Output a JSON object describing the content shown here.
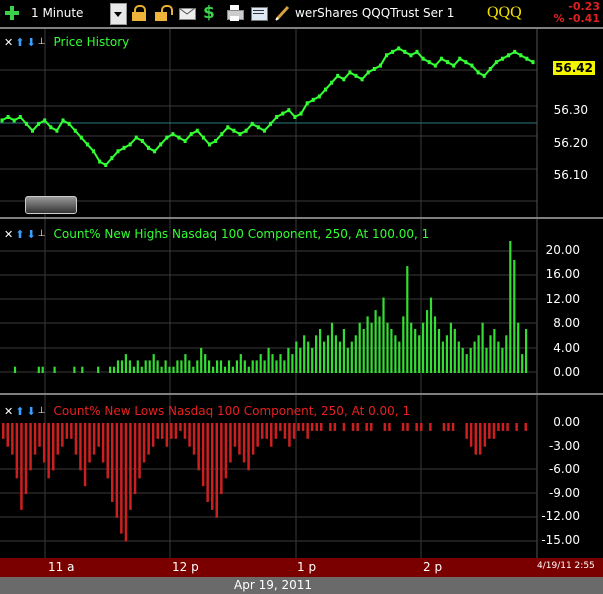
{
  "toolbar": {
    "interval_label": "1 Minute",
    "symbol_name": "werShares QQQTrust Ser 1",
    "ticker": "QQQ",
    "change": "-0.23",
    "change_pct": "% -0.41"
  },
  "pane1": {
    "title": "Price History",
    "last_price": "56.42",
    "axis": [
      "56.30",
      "56.20",
      "56.10"
    ]
  },
  "pane2": {
    "title": "Count% New Highs Nasdaq 100 Component, 250, At 100.00, 1",
    "axis": [
      "20.00",
      "16.00",
      "12.00",
      "8.00",
      "4.00",
      "0.00"
    ]
  },
  "pane3": {
    "title": "Count% New Lows Nasdaq 100 Component, 250, At 0.00, 1",
    "axis": [
      "0.00",
      "-3.00",
      "-6.00",
      "-9.00",
      "-12.00",
      "-15.00"
    ]
  },
  "footer": {
    "time_labels": [
      "11 a",
      "12 p",
      "1 p",
      "2 p"
    ],
    "timestamp": "4/19/11 2:55",
    "date": "Apr 19, 2011"
  },
  "colors": {
    "price_line": "#33ff33",
    "highs": "#33dd33",
    "lows": "#cc2020",
    "footer": "#7a0000"
  },
  "chart_data": [
    {
      "type": "line",
      "ylim": [
        56.05,
        56.47
      ],
      "x_labels": [
        "11 a",
        "12 p",
        "1 p",
        "2 p"
      ],
      "series": [
        {
          "values": [
            56.25,
            56.26,
            56.25,
            56.26,
            56.24,
            56.22,
            56.24,
            56.25,
            56.23,
            56.22,
            56.25,
            56.24,
            56.22,
            56.2,
            56.18,
            56.16,
            56.13,
            56.12,
            56.14,
            56.16,
            56.17,
            56.18,
            56.2,
            56.19,
            56.17,
            56.16,
            56.18,
            56.2,
            56.21,
            56.2,
            56.19,
            56.21,
            56.22,
            56.2,
            56.18,
            56.19,
            56.21,
            56.23,
            56.22,
            56.21,
            56.22,
            56.24,
            56.23,
            56.22,
            56.24,
            56.26,
            56.27,
            56.28,
            56.26,
            56.27,
            56.3,
            56.31,
            56.32,
            56.34,
            56.36,
            56.38,
            56.37,
            56.39,
            56.38,
            56.37,
            56.39,
            56.4,
            56.41,
            56.44,
            56.45,
            56.46,
            56.45,
            56.44,
            56.45,
            56.43,
            56.42,
            56.41,
            56.43,
            56.42,
            56.41,
            56.43,
            56.42,
            56.41,
            56.39,
            56.38,
            56.4,
            56.42,
            56.43,
            56.44,
            56.45,
            56.44,
            56.43,
            56.42
          ]
        }
      ]
    },
    {
      "type": "bar",
      "ylim": [
        0,
        21
      ],
      "values": [
        0,
        0,
        0,
        1,
        0,
        0,
        0,
        0,
        0,
        1,
        1,
        0,
        0,
        1,
        0,
        0,
        0,
        0,
        1,
        0,
        1,
        0,
        0,
        0,
        1,
        0,
        0,
        1,
        1,
        2,
        2,
        3,
        2,
        1,
        2,
        1,
        2,
        2,
        3,
        2,
        1,
        2,
        1,
        1,
        2,
        2,
        3,
        2,
        1,
        2,
        4,
        3,
        2,
        1,
        2,
        2,
        1,
        2,
        1,
        2,
        3,
        2,
        1,
        2,
        2,
        3,
        2,
        4,
        3,
        2,
        3,
        2,
        4,
        3,
        5,
        4,
        6,
        5,
        4,
        6,
        7,
        5,
        6,
        8,
        6,
        5,
        7,
        4,
        5,
        6,
        8,
        7,
        9,
        8,
        10,
        9,
        12,
        8,
        7,
        6,
        5,
        9,
        17,
        8,
        7,
        6,
        8,
        10,
        12,
        9,
        7,
        5,
        6,
        8,
        7,
        5,
        4,
        3,
        4,
        5,
        6,
        8,
        4,
        6,
        7,
        5,
        4,
        6,
        21,
        18,
        8,
        3,
        7
      ]
    },
    {
      "type": "bar",
      "ylim": [
        -16,
        1
      ],
      "values": [
        -2,
        -3,
        -4,
        -7,
        -11,
        -9,
        -6,
        -4,
        -3,
        -5,
        -7,
        -6,
        -4,
        -3,
        -2,
        -2,
        -4,
        -6,
        -8,
        -5,
        -4,
        -3,
        -5,
        -7,
        -10,
        -12,
        -14,
        -15,
        -11,
        -9,
        -7,
        -5,
        -4,
        -3,
        -2,
        -2,
        -3,
        -2,
        -2,
        -1,
        -2,
        -3,
        -4,
        -6,
        -8,
        -10,
        -11,
        -12,
        -9,
        -7,
        -5,
        -3,
        -4,
        -5,
        -6,
        -4,
        -3,
        -2,
        -2,
        -3,
        -2,
        -1,
        -2,
        -3,
        -2,
        -1,
        -1,
        -2,
        -1,
        -1,
        -1,
        0,
        -1,
        -1,
        0,
        -1,
        0,
        -1,
        -1,
        0,
        -1,
        -1,
        0,
        0,
        -1,
        -1,
        0,
        0,
        -1,
        -1,
        0,
        -1,
        -1,
        0,
        -1,
        0,
        0,
        -1,
        -1,
        -1,
        0,
        0,
        -2,
        -3,
        -4,
        -4,
        -3,
        -2,
        -2,
        -1,
        -1,
        -1,
        0,
        -1,
        0,
        -1
      ]
    }
  ]
}
